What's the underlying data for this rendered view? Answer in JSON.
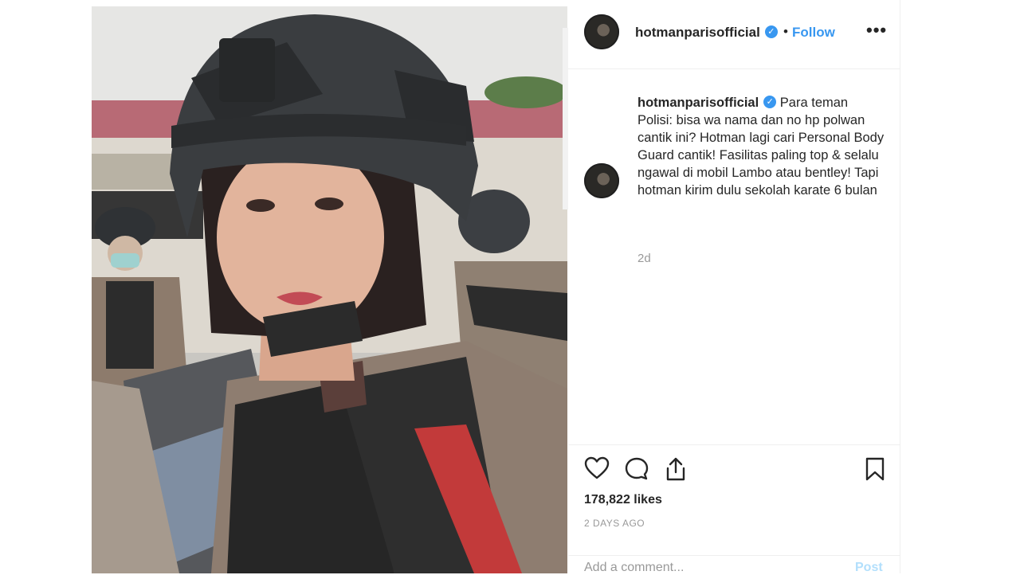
{
  "post": {
    "username": "hotmanparisofficial",
    "verified_glyph": "✓",
    "separator": "•",
    "follow_label": "Follow",
    "more_label": "•••",
    "caption_text": "Para teman Polisi: bisa wa nama dan no hp polwan cantik ini? Hotman lagi cari Personal Body Guard cantik! Fasilitas paling top & selalu ngawal di mobil Lambo atau bentley! Tapi hotman kirim dulu sekolah karate 6 bulan",
    "relative_time": "2d",
    "likes": "178,822 likes",
    "posted_ago": "2 DAYS AGO",
    "comment_placeholder": "Add a comment...",
    "post_label": "Post"
  },
  "icons": {
    "like": "heart-icon",
    "comment": "comment-icon",
    "share": "share-icon",
    "save": "bookmark-icon",
    "verified": "verified-badge-icon"
  },
  "colors": {
    "link_blue": "#3897f0",
    "muted_text": "#999999",
    "post_disabled": "#b2dffc"
  }
}
